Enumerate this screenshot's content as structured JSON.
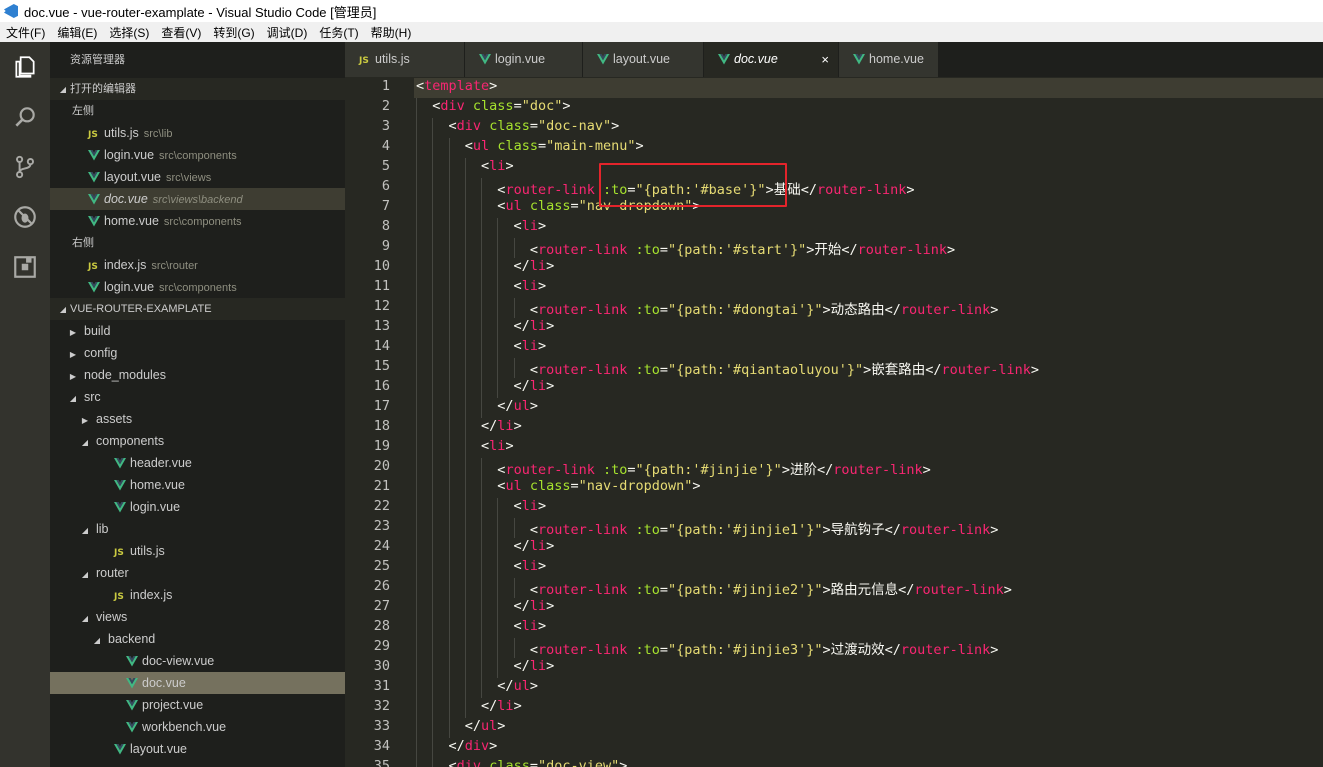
{
  "window": {
    "title": "doc.vue - vue-router-examplate - Visual Studio Code [管理员]"
  },
  "menu": [
    "文件(F)",
    "编辑(E)",
    "选择(S)",
    "查看(V)",
    "转到(G)",
    "调试(D)",
    "任务(T)",
    "帮助(H)"
  ],
  "activity_bar": [
    "files-icon",
    "search-icon",
    "source-control-icon",
    "debug-icon",
    "extensions-icon"
  ],
  "sidebar": {
    "title": "资源管理器",
    "open_editors": {
      "header": "打开的编辑器",
      "groups": [
        {
          "name": "左侧",
          "files": [
            {
              "name": "utils.js",
              "path": "src\\lib",
              "icon": "js"
            },
            {
              "name": "login.vue",
              "path": "src\\components",
              "icon": "vue"
            },
            {
              "name": "layout.vue",
              "path": "src\\views",
              "icon": "vue"
            },
            {
              "name": "doc.vue",
              "path": "src\\views\\backend",
              "icon": "vue",
              "active": true
            },
            {
              "name": "home.vue",
              "path": "src\\components",
              "icon": "vue"
            }
          ]
        },
        {
          "name": "右侧",
          "files": [
            {
              "name": "index.js",
              "path": "src\\router",
              "icon": "js"
            },
            {
              "name": "login.vue",
              "path": "src\\components",
              "icon": "vue"
            }
          ]
        }
      ]
    },
    "project": {
      "header": "VUE-ROUTER-EXAMPLATE",
      "tree": [
        {
          "label": "build",
          "depth": 0,
          "type": "folder",
          "open": false
        },
        {
          "label": "config",
          "depth": 0,
          "type": "folder",
          "open": false
        },
        {
          "label": "node_modules",
          "depth": 0,
          "type": "folder",
          "open": false
        },
        {
          "label": "src",
          "depth": 0,
          "type": "folder",
          "open": true
        },
        {
          "label": "assets",
          "depth": 1,
          "type": "folder",
          "open": false
        },
        {
          "label": "components",
          "depth": 1,
          "type": "folder",
          "open": true
        },
        {
          "label": "header.vue",
          "depth": 2,
          "type": "vue"
        },
        {
          "label": "home.vue",
          "depth": 2,
          "type": "vue"
        },
        {
          "label": "login.vue",
          "depth": 2,
          "type": "vue"
        },
        {
          "label": "lib",
          "depth": 1,
          "type": "folder",
          "open": true
        },
        {
          "label": "utils.js",
          "depth": 2,
          "type": "js"
        },
        {
          "label": "router",
          "depth": 1,
          "type": "folder",
          "open": true
        },
        {
          "label": "index.js",
          "depth": 2,
          "type": "js"
        },
        {
          "label": "views",
          "depth": 1,
          "type": "folder",
          "open": true
        },
        {
          "label": "backend",
          "depth": 2,
          "type": "folder",
          "open": true
        },
        {
          "label": "doc-view.vue",
          "depth": 3,
          "type": "vue"
        },
        {
          "label": "doc.vue",
          "depth": 3,
          "type": "vue",
          "selected": true
        },
        {
          "label": "project.vue",
          "depth": 3,
          "type": "vue"
        },
        {
          "label": "workbench.vue",
          "depth": 3,
          "type": "vue"
        },
        {
          "label": "layout.vue",
          "depth": 2,
          "type": "vue"
        }
      ]
    }
  },
  "tabs": [
    {
      "label": "utils.js",
      "icon": "js",
      "active": false
    },
    {
      "label": "login.vue",
      "icon": "vue",
      "active": false
    },
    {
      "label": "layout.vue",
      "icon": "vue",
      "active": false
    },
    {
      "label": "doc.vue",
      "icon": "vue",
      "active": true,
      "close": "×"
    },
    {
      "label": "home.vue",
      "icon": "vue",
      "active": false
    }
  ],
  "editor": {
    "current_line": 1,
    "lines": [
      {
        "n": "1",
        "indent": 0,
        "tokens": [
          [
            "t",
            "<"
          ],
          [
            "g",
            "template"
          ],
          [
            "t",
            ">"
          ]
        ]
      },
      {
        "n": "2",
        "indent": 1,
        "tokens": [
          [
            "t",
            "<"
          ],
          [
            "g",
            "div"
          ],
          [
            "t",
            " "
          ],
          [
            "a",
            "class"
          ],
          [
            "t",
            "="
          ],
          [
            "s",
            "\"doc\""
          ],
          [
            "t",
            ">"
          ]
        ]
      },
      {
        "n": "3",
        "indent": 2,
        "tokens": [
          [
            "t",
            "<"
          ],
          [
            "g",
            "div"
          ],
          [
            "t",
            " "
          ],
          [
            "a",
            "class"
          ],
          [
            "t",
            "="
          ],
          [
            "s",
            "\"doc-nav\""
          ],
          [
            "t",
            ">"
          ]
        ]
      },
      {
        "n": "4",
        "indent": 3,
        "tokens": [
          [
            "t",
            "<"
          ],
          [
            "g",
            "ul"
          ],
          [
            "t",
            " "
          ],
          [
            "a",
            "class"
          ],
          [
            "t",
            "="
          ],
          [
            "s",
            "\"main-menu\""
          ],
          [
            "t",
            ">"
          ]
        ]
      },
      {
        "n": "5",
        "indent": 4,
        "tokens": [
          [
            "t",
            "<"
          ],
          [
            "g",
            "li"
          ],
          [
            "t",
            ">"
          ]
        ]
      },
      {
        "n": "6",
        "indent": 5,
        "tokens": [
          [
            "t",
            "<"
          ],
          [
            "g",
            "router-link"
          ],
          [
            "t",
            " "
          ],
          [
            "a",
            ":to"
          ],
          [
            "t",
            "="
          ],
          [
            "s",
            "\"{path:'#base'}\""
          ],
          [
            "t",
            ">基础</"
          ],
          [
            "g",
            "router-link"
          ],
          [
            "t",
            ">"
          ]
        ]
      },
      {
        "n": "7",
        "indent": 5,
        "tokens": [
          [
            "t",
            "<"
          ],
          [
            "g",
            "ul"
          ],
          [
            "t",
            " "
          ],
          [
            "a",
            "class"
          ],
          [
            "t",
            "="
          ],
          [
            "s",
            "\"nav-dropdown\""
          ],
          [
            "t",
            ">"
          ]
        ]
      },
      {
        "n": "8",
        "indent": 6,
        "tokens": [
          [
            "t",
            "<"
          ],
          [
            "g",
            "li"
          ],
          [
            "t",
            ">"
          ]
        ]
      },
      {
        "n": "9",
        "indent": 7,
        "tokens": [
          [
            "t",
            "<"
          ],
          [
            "g",
            "router-link"
          ],
          [
            "t",
            " "
          ],
          [
            "a",
            ":to"
          ],
          [
            "t",
            "="
          ],
          [
            "s",
            "\"{path:'#start'}\""
          ],
          [
            "t",
            ">开始</"
          ],
          [
            "g",
            "router-link"
          ],
          [
            "t",
            ">"
          ]
        ]
      },
      {
        "n": "10",
        "indent": 6,
        "tokens": [
          [
            "t",
            "</"
          ],
          [
            "g",
            "li"
          ],
          [
            "t",
            ">"
          ]
        ]
      },
      {
        "n": "11",
        "indent": 6,
        "tokens": [
          [
            "t",
            "<"
          ],
          [
            "g",
            "li"
          ],
          [
            "t",
            ">"
          ]
        ]
      },
      {
        "n": "12",
        "indent": 7,
        "tokens": [
          [
            "t",
            "<"
          ],
          [
            "g",
            "router-link"
          ],
          [
            "t",
            " "
          ],
          [
            "a",
            ":to"
          ],
          [
            "t",
            "="
          ],
          [
            "s",
            "\"{path:'#dongtai'}\""
          ],
          [
            "t",
            ">动态路由</"
          ],
          [
            "g",
            "router-link"
          ],
          [
            "t",
            ">"
          ]
        ]
      },
      {
        "n": "13",
        "indent": 6,
        "tokens": [
          [
            "t",
            "</"
          ],
          [
            "g",
            "li"
          ],
          [
            "t",
            ">"
          ]
        ]
      },
      {
        "n": "14",
        "indent": 6,
        "tokens": [
          [
            "t",
            "<"
          ],
          [
            "g",
            "li"
          ],
          [
            "t",
            ">"
          ]
        ]
      },
      {
        "n": "15",
        "indent": 7,
        "tokens": [
          [
            "t",
            "<"
          ],
          [
            "g",
            "router-link"
          ],
          [
            "t",
            " "
          ],
          [
            "a",
            ":to"
          ],
          [
            "t",
            "="
          ],
          [
            "s",
            "\"{path:'#qiantaoluyou'}\""
          ],
          [
            "t",
            ">嵌套路由</"
          ],
          [
            "g",
            "router-link"
          ],
          [
            "t",
            ">"
          ]
        ]
      },
      {
        "n": "16",
        "indent": 6,
        "tokens": [
          [
            "t",
            "</"
          ],
          [
            "g",
            "li"
          ],
          [
            "t",
            ">"
          ]
        ]
      },
      {
        "n": "17",
        "indent": 5,
        "tokens": [
          [
            "t",
            "</"
          ],
          [
            "g",
            "ul"
          ],
          [
            "t",
            ">"
          ]
        ]
      },
      {
        "n": "18",
        "indent": 4,
        "tokens": [
          [
            "t",
            "</"
          ],
          [
            "g",
            "li"
          ],
          [
            "t",
            ">"
          ]
        ]
      },
      {
        "n": "19",
        "indent": 4,
        "tokens": [
          [
            "t",
            "<"
          ],
          [
            "g",
            "li"
          ],
          [
            "t",
            ">"
          ]
        ]
      },
      {
        "n": "20",
        "indent": 5,
        "tokens": [
          [
            "t",
            "<"
          ],
          [
            "g",
            "router-link"
          ],
          [
            "t",
            " "
          ],
          [
            "a",
            ":to"
          ],
          [
            "t",
            "="
          ],
          [
            "s",
            "\"{path:'#jinjie'}\""
          ],
          [
            "t",
            ">进阶</"
          ],
          [
            "g",
            "router-link"
          ],
          [
            "t",
            ">"
          ]
        ]
      },
      {
        "n": "21",
        "indent": 5,
        "tokens": [
          [
            "t",
            "<"
          ],
          [
            "g",
            "ul"
          ],
          [
            "t",
            " "
          ],
          [
            "a",
            "class"
          ],
          [
            "t",
            "="
          ],
          [
            "s",
            "\"nav-dropdown\""
          ],
          [
            "t",
            ">"
          ]
        ]
      },
      {
        "n": "22",
        "indent": 6,
        "tokens": [
          [
            "t",
            "<"
          ],
          [
            "g",
            "li"
          ],
          [
            "t",
            ">"
          ]
        ]
      },
      {
        "n": "23",
        "indent": 7,
        "tokens": [
          [
            "t",
            "<"
          ],
          [
            "g",
            "router-link"
          ],
          [
            "t",
            " "
          ],
          [
            "a",
            ":to"
          ],
          [
            "t",
            "="
          ],
          [
            "s",
            "\"{path:'#jinjie1'}\""
          ],
          [
            "t",
            ">导航钩子</"
          ],
          [
            "g",
            "router-link"
          ],
          [
            "t",
            ">"
          ]
        ]
      },
      {
        "n": "24",
        "indent": 6,
        "tokens": [
          [
            "t",
            "</"
          ],
          [
            "g",
            "li"
          ],
          [
            "t",
            ">"
          ]
        ]
      },
      {
        "n": "25",
        "indent": 6,
        "tokens": [
          [
            "t",
            "<"
          ],
          [
            "g",
            "li"
          ],
          [
            "t",
            ">"
          ]
        ]
      },
      {
        "n": "26",
        "indent": 7,
        "tokens": [
          [
            "t",
            "<"
          ],
          [
            "g",
            "router-link"
          ],
          [
            "t",
            " "
          ],
          [
            "a",
            ":to"
          ],
          [
            "t",
            "="
          ],
          [
            "s",
            "\"{path:'#jinjie2'}\""
          ],
          [
            "t",
            ">路由元信息</"
          ],
          [
            "g",
            "router-link"
          ],
          [
            "t",
            ">"
          ]
        ]
      },
      {
        "n": "27",
        "indent": 6,
        "tokens": [
          [
            "t",
            "</"
          ],
          [
            "g",
            "li"
          ],
          [
            "t",
            ">"
          ]
        ]
      },
      {
        "n": "28",
        "indent": 6,
        "tokens": [
          [
            "t",
            "<"
          ],
          [
            "g",
            "li"
          ],
          [
            "t",
            ">"
          ]
        ]
      },
      {
        "n": "29",
        "indent": 7,
        "tokens": [
          [
            "t",
            "<"
          ],
          [
            "g",
            "router-link"
          ],
          [
            "t",
            " "
          ],
          [
            "a",
            ":to"
          ],
          [
            "t",
            "="
          ],
          [
            "s",
            "\"{path:'#jinjie3'}\""
          ],
          [
            "t",
            ">过渡动效</"
          ],
          [
            "g",
            "router-link"
          ],
          [
            "t",
            ">"
          ]
        ]
      },
      {
        "n": "30",
        "indent": 6,
        "tokens": [
          [
            "t",
            "</"
          ],
          [
            "g",
            "li"
          ],
          [
            "t",
            ">"
          ]
        ]
      },
      {
        "n": "31",
        "indent": 5,
        "tokens": [
          [
            "t",
            "</"
          ],
          [
            "g",
            "ul"
          ],
          [
            "t",
            ">"
          ]
        ]
      },
      {
        "n": "32",
        "indent": 4,
        "tokens": [
          [
            "t",
            "</"
          ],
          [
            "g",
            "li"
          ],
          [
            "t",
            ">"
          ]
        ]
      },
      {
        "n": "33",
        "indent": 3,
        "tokens": [
          [
            "t",
            "</"
          ],
          [
            "g",
            "ul"
          ],
          [
            "t",
            ">"
          ]
        ]
      },
      {
        "n": "34",
        "indent": 2,
        "tokens": [
          [
            "t",
            "</"
          ],
          [
            "g",
            "div"
          ],
          [
            "t",
            ">"
          ]
        ]
      },
      {
        "n": "35",
        "indent": 2,
        "tokens": [
          [
            "t",
            "<"
          ],
          [
            "g",
            "div"
          ],
          [
            "t",
            " "
          ],
          [
            "a",
            "class"
          ],
          [
            "t",
            "="
          ],
          [
            "s",
            "\"doc-view\""
          ],
          [
            "t",
            ">"
          ]
        ]
      }
    ]
  },
  "colors": {
    "editor_bg": "#272822",
    "sidebar_bg": "#1e1f1c",
    "activity_bg": "#33332d",
    "tag": "#f92672",
    "attr": "#a6e22e",
    "string": "#e6db74",
    "text": "#f8f8f2",
    "vue_icon": "#41b883",
    "annotation_box": "#e3242b"
  }
}
